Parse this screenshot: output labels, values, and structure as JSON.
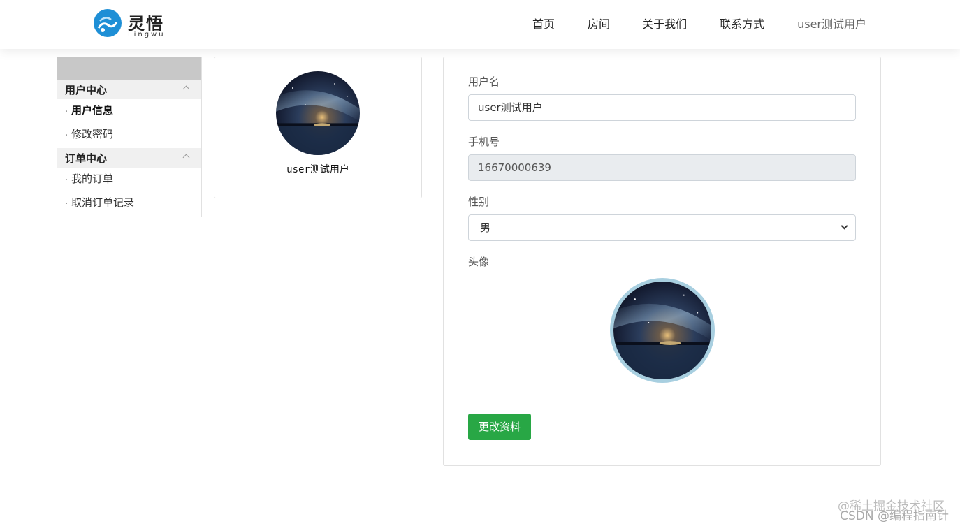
{
  "logo": {
    "cn": "灵悟",
    "en": "Lingwu"
  },
  "nav": {
    "items": [
      "首页",
      "房间",
      "关于我们",
      "联系方式"
    ],
    "user": "user测试用户"
  },
  "sidebar": {
    "groups": [
      {
        "title": "用户中心",
        "items": [
          "用户信息",
          "修改密码"
        ]
      },
      {
        "title": "订单中心",
        "items": [
          "我的订单",
          "取消订单记录"
        ]
      }
    ],
    "active": "用户信息"
  },
  "profile": {
    "name": "user测试用户"
  },
  "form": {
    "username_label": "用户名",
    "username_value": "user测试用户",
    "phone_label": "手机号",
    "phone_value": "16670000639",
    "gender_label": "性别",
    "gender_value": "男",
    "avatar_label": "头像",
    "submit_label": "更改资料"
  },
  "watermark": {
    "line1": "@稀土掘金技术社区",
    "line2": "CSDN @编程指南针"
  },
  "colors": {
    "submit": "#28a745",
    "avatar_border": "#a8cfe0"
  }
}
